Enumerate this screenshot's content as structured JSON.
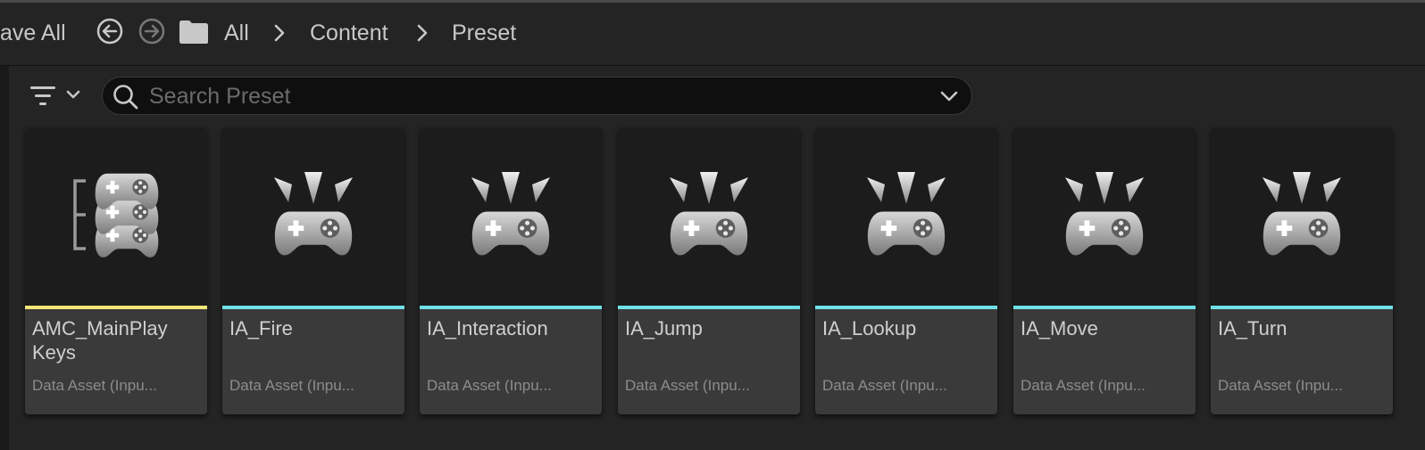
{
  "toolbar": {
    "save_all_label": "ave All",
    "breadcrumb": [
      "All",
      "Content",
      "Preset"
    ]
  },
  "filter": {
    "search_placeholder": "Search Preset"
  },
  "assets": [
    {
      "name": "AMC_MainPlay Keys",
      "type": "Data Asset (Inpu...",
      "accent": "#f2e67a",
      "icon": "mapping-context-icon"
    },
    {
      "name": "IA_Fire",
      "type": "Data Asset (Inpu...",
      "accent": "#6fe0e8",
      "icon": "input-action-icon"
    },
    {
      "name": "IA_Interaction",
      "type": "Data Asset (Inpu...",
      "accent": "#6fe0e8",
      "icon": "input-action-icon"
    },
    {
      "name": "IA_Jump",
      "type": "Data Asset (Inpu...",
      "accent": "#6fe0e8",
      "icon": "input-action-icon"
    },
    {
      "name": "IA_Lookup",
      "type": "Data Asset (Inpu...",
      "accent": "#6fe0e8",
      "icon": "input-action-icon"
    },
    {
      "name": "IA_Move",
      "type": "Data Asset (Inpu...",
      "accent": "#6fe0e8",
      "icon": "input-action-icon"
    },
    {
      "name": "IA_Turn",
      "type": "Data Asset (Inpu...",
      "accent": "#6fe0e8",
      "icon": "input-action-icon"
    }
  ]
}
